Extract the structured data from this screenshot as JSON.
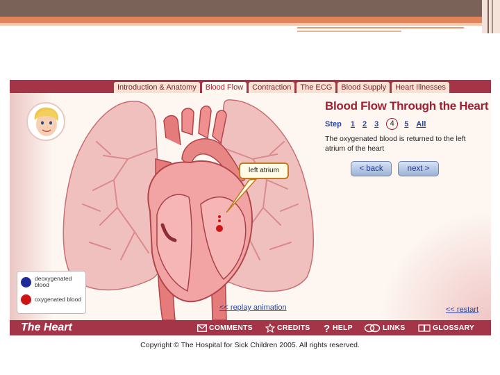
{
  "app": {
    "brand": "The Heart"
  },
  "tabs": [
    {
      "label": "Introduction & Anatomy",
      "active": false
    },
    {
      "label": "Blood Flow",
      "active": true
    },
    {
      "label": "Contraction",
      "active": false
    },
    {
      "label": "The ECG",
      "active": false
    },
    {
      "label": "Blood Supply",
      "active": false
    },
    {
      "label": "Heart Illnesses",
      "active": false
    }
  ],
  "panel": {
    "title": "Blood Flow Through the Heart",
    "step_label": "Step",
    "steps": [
      "1",
      "2",
      "3",
      "4",
      "5",
      "All"
    ],
    "current_step": "4",
    "description": "The oxygenated blood is returned to the left atrium of the heart",
    "back_label": "< back",
    "next_label": "next >"
  },
  "callout": {
    "label": "left atrium"
  },
  "legend": {
    "items": [
      {
        "label": "deoxygenated blood",
        "color": "#1f2a9a"
      },
      {
        "label": "oxygenated blood",
        "color": "#cc1515"
      }
    ]
  },
  "links": {
    "replay": "<< replay animation",
    "restart": "<< restart"
  },
  "bottom_nav": [
    {
      "label": "COMMENTS",
      "icon": "envelope-icon"
    },
    {
      "label": "CREDITS",
      "icon": "star-icon"
    },
    {
      "label": "HELP",
      "icon": "question-icon"
    },
    {
      "label": "LINKS",
      "icon": "chain-icon"
    },
    {
      "label": "GLOSSARY",
      "icon": "book-icon"
    }
  ],
  "colors": {
    "frame": "#a43549",
    "title": "#a01f30",
    "link": "#26449e"
  },
  "footer": {
    "copyright": "Copyright © The Hospital for Sick Children 2005. All rights reserved."
  }
}
